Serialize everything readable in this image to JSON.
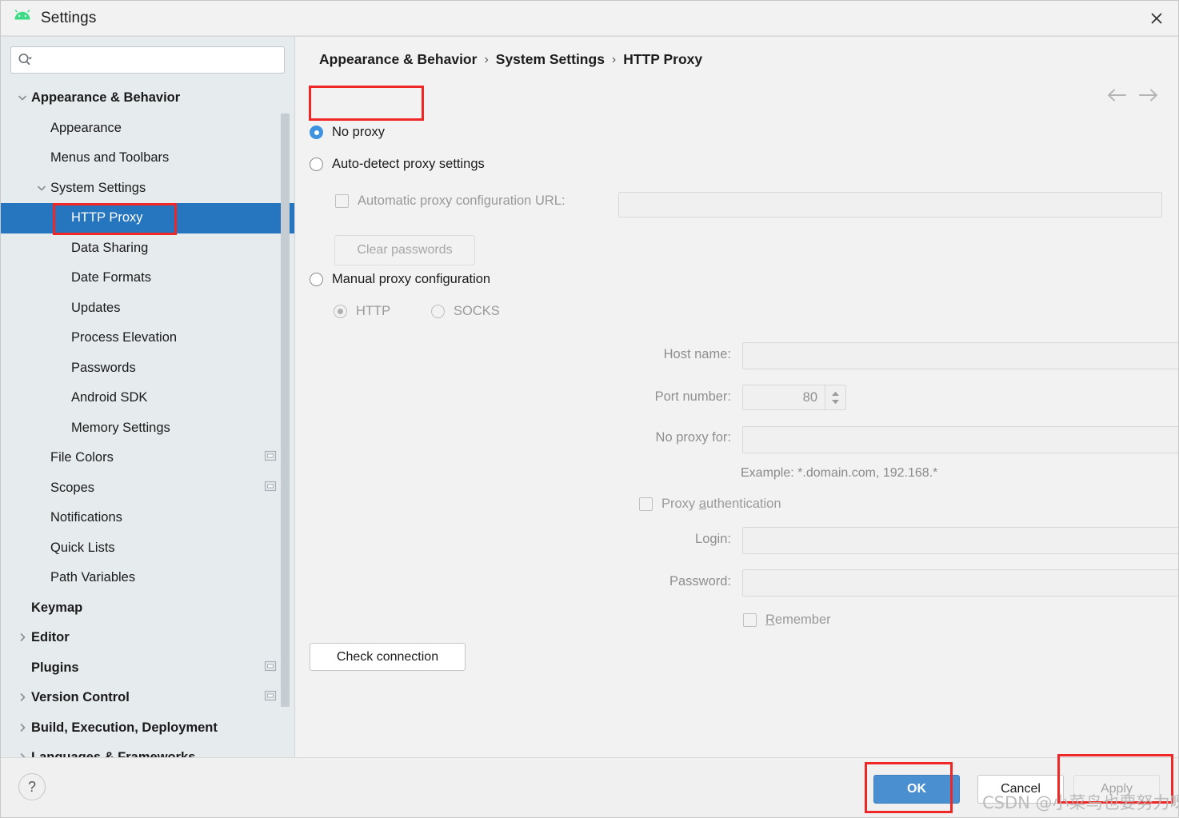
{
  "window": {
    "title": "Settings",
    "app_icon": "android-icon",
    "close_icon": "close-icon"
  },
  "sidebar": {
    "search": {
      "value": "",
      "placeholder": "",
      "icon": "search-icon"
    },
    "items": [
      {
        "label": "Appearance & Behavior",
        "indent": 0,
        "bold": true,
        "arrow": "down",
        "badge": false,
        "selected": false
      },
      {
        "label": "Appearance",
        "indent": 1,
        "bold": false,
        "arrow": "none",
        "badge": false,
        "selected": false
      },
      {
        "label": "Menus and Toolbars",
        "indent": 1,
        "bold": false,
        "arrow": "none",
        "badge": false,
        "selected": false
      },
      {
        "label": "System Settings",
        "indent": 1,
        "bold": false,
        "arrow": "down",
        "badge": false,
        "selected": false
      },
      {
        "label": "HTTP Proxy",
        "indent": 2,
        "bold": false,
        "arrow": "none",
        "badge": false,
        "selected": true
      },
      {
        "label": "Data Sharing",
        "indent": 2,
        "bold": false,
        "arrow": "none",
        "badge": false,
        "selected": false
      },
      {
        "label": "Date Formats",
        "indent": 2,
        "bold": false,
        "arrow": "none",
        "badge": false,
        "selected": false
      },
      {
        "label": "Updates",
        "indent": 2,
        "bold": false,
        "arrow": "none",
        "badge": false,
        "selected": false
      },
      {
        "label": "Process Elevation",
        "indent": 2,
        "bold": false,
        "arrow": "none",
        "badge": false,
        "selected": false
      },
      {
        "label": "Passwords",
        "indent": 2,
        "bold": false,
        "arrow": "none",
        "badge": false,
        "selected": false
      },
      {
        "label": "Android SDK",
        "indent": 2,
        "bold": false,
        "arrow": "none",
        "badge": false,
        "selected": false
      },
      {
        "label": "Memory Settings",
        "indent": 2,
        "bold": false,
        "arrow": "none",
        "badge": false,
        "selected": false
      },
      {
        "label": "File Colors",
        "indent": 1,
        "bold": false,
        "arrow": "none",
        "badge": true,
        "selected": false
      },
      {
        "label": "Scopes",
        "indent": 1,
        "bold": false,
        "arrow": "none",
        "badge": true,
        "selected": false
      },
      {
        "label": "Notifications",
        "indent": 1,
        "bold": false,
        "arrow": "none",
        "badge": false,
        "selected": false
      },
      {
        "label": "Quick Lists",
        "indent": 1,
        "bold": false,
        "arrow": "none",
        "badge": false,
        "selected": false
      },
      {
        "label": "Path Variables",
        "indent": 1,
        "bold": false,
        "arrow": "none",
        "badge": false,
        "selected": false
      },
      {
        "label": "Keymap",
        "indent": 0,
        "bold": true,
        "arrow": "none",
        "badge": false,
        "selected": false
      },
      {
        "label": "Editor",
        "indent": 0,
        "bold": true,
        "arrow": "right",
        "badge": false,
        "selected": false
      },
      {
        "label": "Plugins",
        "indent": 0,
        "bold": true,
        "arrow": "none",
        "badge": true,
        "selected": false
      },
      {
        "label": "Version Control",
        "indent": 0,
        "bold": true,
        "arrow": "right",
        "badge": true,
        "selected": false
      },
      {
        "label": "Build, Execution, Deployment",
        "indent": 0,
        "bold": true,
        "arrow": "right",
        "badge": false,
        "selected": false
      },
      {
        "label": "Languages & Frameworks",
        "indent": 0,
        "bold": true,
        "arrow": "right",
        "badge": false,
        "selected": false
      }
    ]
  },
  "main": {
    "breadcrumb": [
      "Appearance & Behavior",
      "System Settings",
      "HTTP Proxy"
    ],
    "breadcrumb_separator": "›",
    "nav_back_icon": "arrow-left-icon",
    "nav_forward_icon": "arrow-right-icon",
    "proxy_mode": "no_proxy",
    "options": {
      "no_proxy": "No proxy",
      "auto_detect": "Auto-detect proxy settings",
      "manual": "Manual proxy configuration"
    },
    "auto_pac_checkbox_label": "Automatic proxy configuration URL:",
    "auto_pac_url_value": "",
    "clear_passwords_label": "Clear passwords",
    "protocol": {
      "http": "HTTP",
      "socks": "SOCKS",
      "selected": "HTTP"
    },
    "fields": {
      "host_label": "Host name:",
      "host_value": "",
      "port_label": "Port number:",
      "port_value": "80",
      "no_proxy_for_label": "No proxy for:",
      "no_proxy_for_value": "",
      "example_note": "Example: *.domain.com, 192.168.*",
      "expand_icon": "expand-icon"
    },
    "auth": {
      "checkbox_label_pre": "Proxy ",
      "checkbox_label_mnemonic": "a",
      "checkbox_label_post": "uthentication",
      "login_label": "Login:",
      "login_value": "",
      "password_label": "Password:",
      "password_value": "",
      "remember_mnemonic": "R",
      "remember_post": "emember"
    },
    "check_connection_label": "Check connection"
  },
  "footer": {
    "help_label": "?",
    "ok_label": "OK",
    "cancel_label": "Cancel",
    "apply_label": "Apply",
    "apply_enabled": false
  },
  "watermark": "CSDN @小菜鸟也要努力呀",
  "colors": {
    "selection_blue": "#2675bf",
    "radio_blue": "#3d93e0",
    "ok_button_blue": "#4a8fd0",
    "annotation_red": "#f02727",
    "sidebar_bg": "#e6ebee",
    "panel_bg": "#f2f2f2"
  }
}
